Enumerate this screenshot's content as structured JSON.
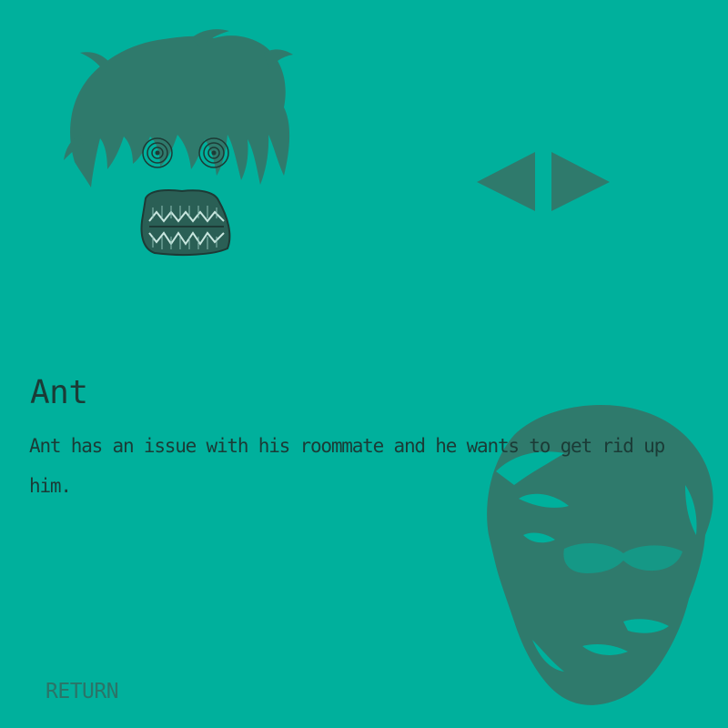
{
  "character": {
    "name": "Ant",
    "description": "Ant has an issue with his roommate and he wants to get rid up him."
  },
  "navigation": {
    "prev_icon": "triangle-left-icon",
    "next_icon": "triangle-right-icon",
    "return_label": "RETURN"
  },
  "colors": {
    "background": "#00b09c",
    "silhouette": "#2f7a6c",
    "text": "#1b3b36",
    "return_text": "#2b7468"
  }
}
